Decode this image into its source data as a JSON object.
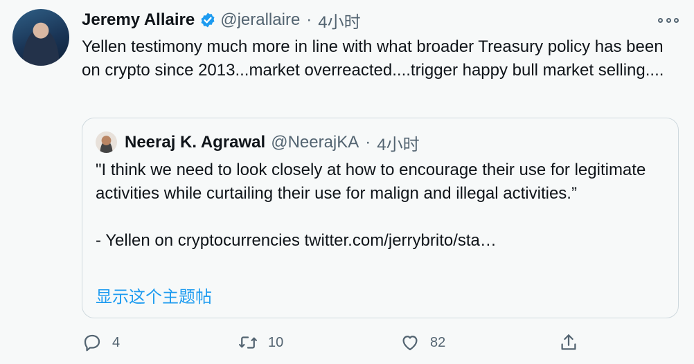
{
  "tweet": {
    "author_name": "Jeremy Allaire",
    "handle": "@jerallaire",
    "separator": "·",
    "time": "4小时",
    "text": "Yellen testimony much more in line with what broader Treasury policy has been on crypto since 2013...market overreacted....trigger happy bull market selling...."
  },
  "quoted": {
    "author_name": "Neeraj K. Agrawal",
    "handle": "@NeerajKA",
    "separator": "·",
    "time": "4小时",
    "text": "\"I think we need to look closely at how to encourage their use for legitimate activities while curtailing their use for malign and illegal activities.”\n\n- Yellen on cryptocurrencies twitter.com/jerrybrito/sta…",
    "show_thread": "显示这个主题帖"
  },
  "actions": {
    "reply_count": "4",
    "retweet_count": "10",
    "like_count": "82"
  },
  "icons": {
    "verified": "verified-badge-icon",
    "more": "more-options-icon",
    "reply": "reply-icon",
    "retweet": "retweet-icon",
    "like": "like-icon",
    "share": "share-icon"
  },
  "colors": {
    "background": "#f7f9f9",
    "text": "#0f1419",
    "muted": "#536471",
    "accent": "#1d9bf0",
    "border": "#cfd9de"
  }
}
